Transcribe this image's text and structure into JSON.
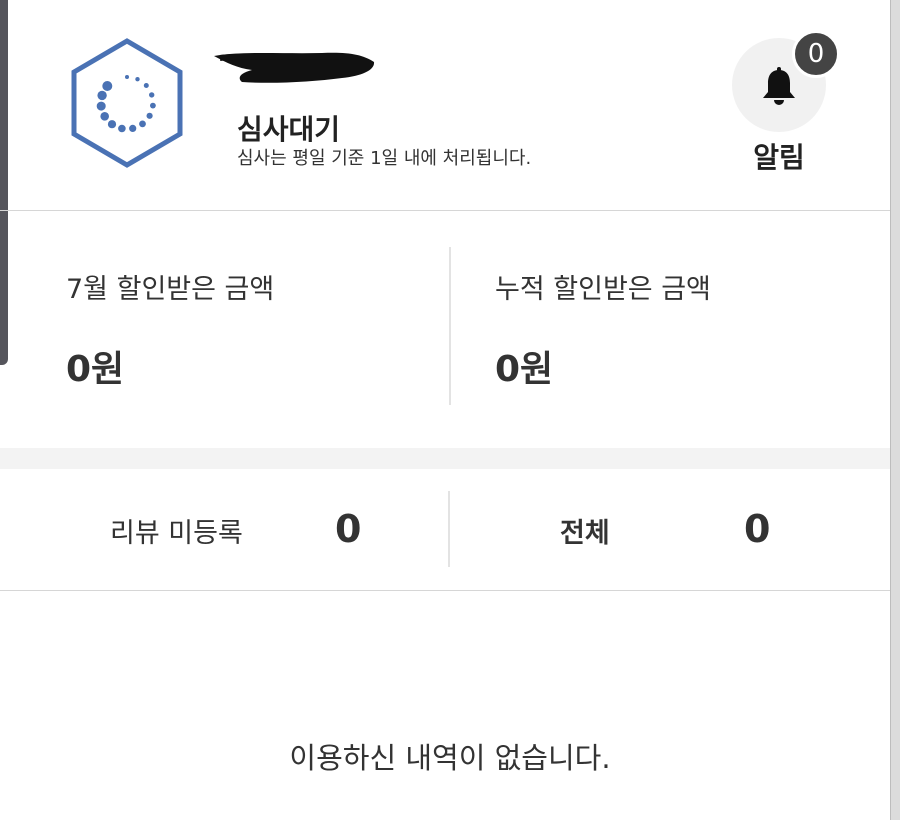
{
  "header": {
    "status_title": "심사대기",
    "status_desc": "심사는 평일 기준 1일 내에 처리됩니다.",
    "status_icon": "loading-spinner-hexagon-icon",
    "notifications": {
      "label": "알림",
      "count": "0",
      "icon": "bell-icon"
    }
  },
  "discount": {
    "monthly_label": "7월 할인받은 금액",
    "monthly_value": "0원",
    "total_label": "누적 할인받은 금액",
    "total_value": "0원"
  },
  "reviews": {
    "unregistered_label": "리뷰 미등록",
    "unregistered_count": "0",
    "all_label": "전체",
    "all_count": "0"
  },
  "history": {
    "empty_message": "이용하신 내역이 없습니다."
  },
  "colors": {
    "accent_blue": "#4a72b4",
    "badge_dark": "#444444"
  }
}
